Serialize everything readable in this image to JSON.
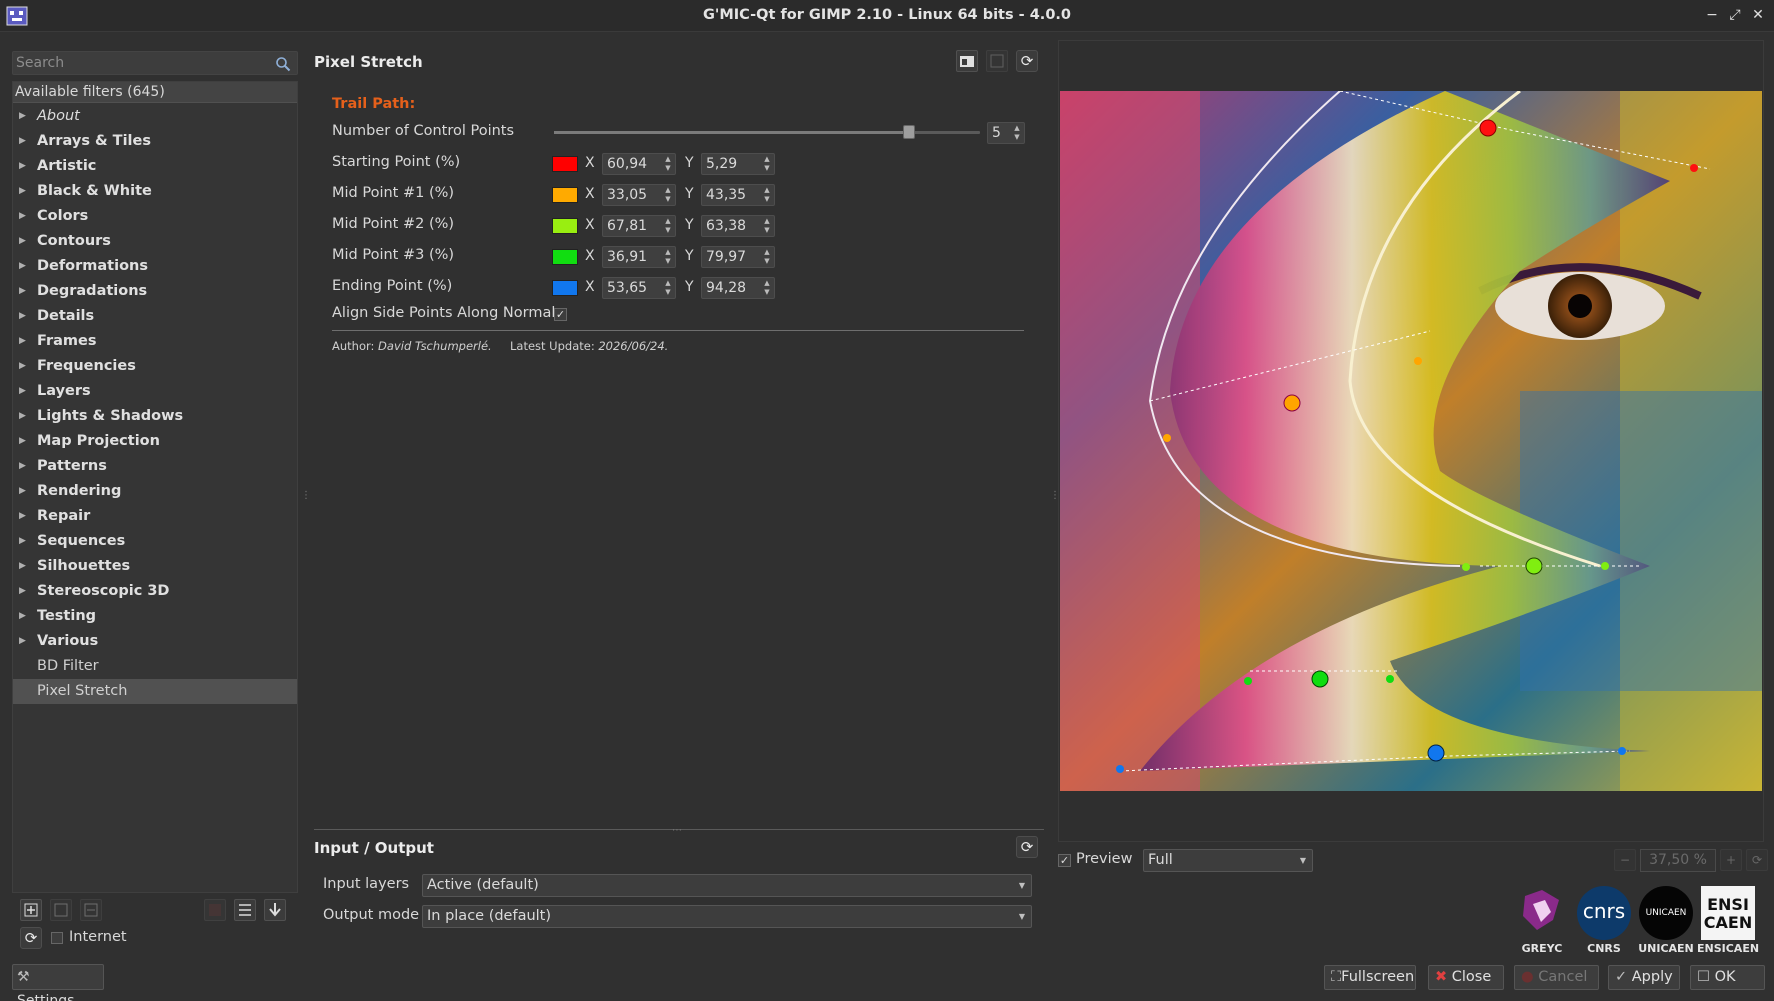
{
  "window": {
    "title": "G'MIC-Qt for GIMP 2.10 - Linux 64 bits - 4.0.0",
    "controls": {
      "minimize": "−",
      "maximize": "⤢",
      "close": "✕"
    }
  },
  "left": {
    "search_placeholder": "Search",
    "tree_header": "Available filters (645)",
    "items": [
      {
        "label": "About",
        "kind": "ital"
      },
      {
        "label": "Arrays & Tiles",
        "kind": "cat"
      },
      {
        "label": "Artistic",
        "kind": "cat"
      },
      {
        "label": "Black & White",
        "kind": "cat"
      },
      {
        "label": "Colors",
        "kind": "cat"
      },
      {
        "label": "Contours",
        "kind": "cat"
      },
      {
        "label": "Deformations",
        "kind": "cat"
      },
      {
        "label": "Degradations",
        "kind": "cat"
      },
      {
        "label": "Details",
        "kind": "cat"
      },
      {
        "label": "Frames",
        "kind": "cat"
      },
      {
        "label": "Frequencies",
        "kind": "cat"
      },
      {
        "label": "Layers",
        "kind": "cat"
      },
      {
        "label": "Lights & Shadows",
        "kind": "cat"
      },
      {
        "label": "Map Projection",
        "kind": "cat"
      },
      {
        "label": "Patterns",
        "kind": "cat"
      },
      {
        "label": "Rendering",
        "kind": "cat"
      },
      {
        "label": "Repair",
        "kind": "cat"
      },
      {
        "label": "Sequences",
        "kind": "cat"
      },
      {
        "label": "Silhouettes",
        "kind": "cat"
      },
      {
        "label": "Stereoscopic 3D",
        "kind": "cat"
      },
      {
        "label": "Testing",
        "kind": "cat"
      },
      {
        "label": "Various",
        "kind": "cat"
      },
      {
        "label": "BD Filter",
        "kind": "leaf"
      },
      {
        "label": "Pixel Stretch",
        "kind": "leaf",
        "selected": true
      }
    ],
    "internet_label": "Internet",
    "settings_label": "Settings..."
  },
  "filter": {
    "title": "Pixel Stretch",
    "section": "Trail Path:",
    "control_points_label": "Number of Control Points",
    "control_points": 5,
    "control_points_max": 6,
    "points": [
      {
        "label": "Starting Point (%)",
        "color": "#ff0000",
        "x": "60,94",
        "y": "5,29"
      },
      {
        "label": "Mid Point #1 (%)",
        "color": "#ffaa00",
        "x": "33,05",
        "y": "43,35"
      },
      {
        "label": "Mid Point #2 (%)",
        "color": "#99ee11",
        "x": "67,81",
        "y": "63,38"
      },
      {
        "label": "Mid Point #3 (%)",
        "color": "#11dd11",
        "x": "36,91",
        "y": "79,97"
      },
      {
        "label": "Ending Point (%)",
        "color": "#1177ee",
        "x": "53,65",
        "y": "94,28"
      }
    ],
    "axis_x": "X",
    "axis_y": "Y",
    "align_label": "Align Side Points Along Normals",
    "align_checked": true,
    "author_prefix": "Author:",
    "author": "David Tschumperlé.",
    "update_prefix": "Latest Update:",
    "update": "2026/06/24."
  },
  "io": {
    "title": "Input / Output",
    "input_label": "Input layers",
    "input_value": "Active (default)",
    "output_label": "Output mode",
    "output_value": "In place (default)"
  },
  "preview": {
    "label": "Preview",
    "checked": true,
    "mode": "Full",
    "zoom": "37,50 %"
  },
  "logos": [
    {
      "caption": "GREYC"
    },
    {
      "caption": "CNRS",
      "text": "cnrs"
    },
    {
      "caption": "UNICAEN",
      "text": "UNICAEN"
    },
    {
      "caption": "ENSICAEN",
      "text": "ENSI CAEN"
    }
  ],
  "buttons": {
    "fullscreen": "Fullscreen",
    "close": "Close",
    "cancel": "Cancel",
    "apply": "Apply",
    "ok": "OK"
  }
}
